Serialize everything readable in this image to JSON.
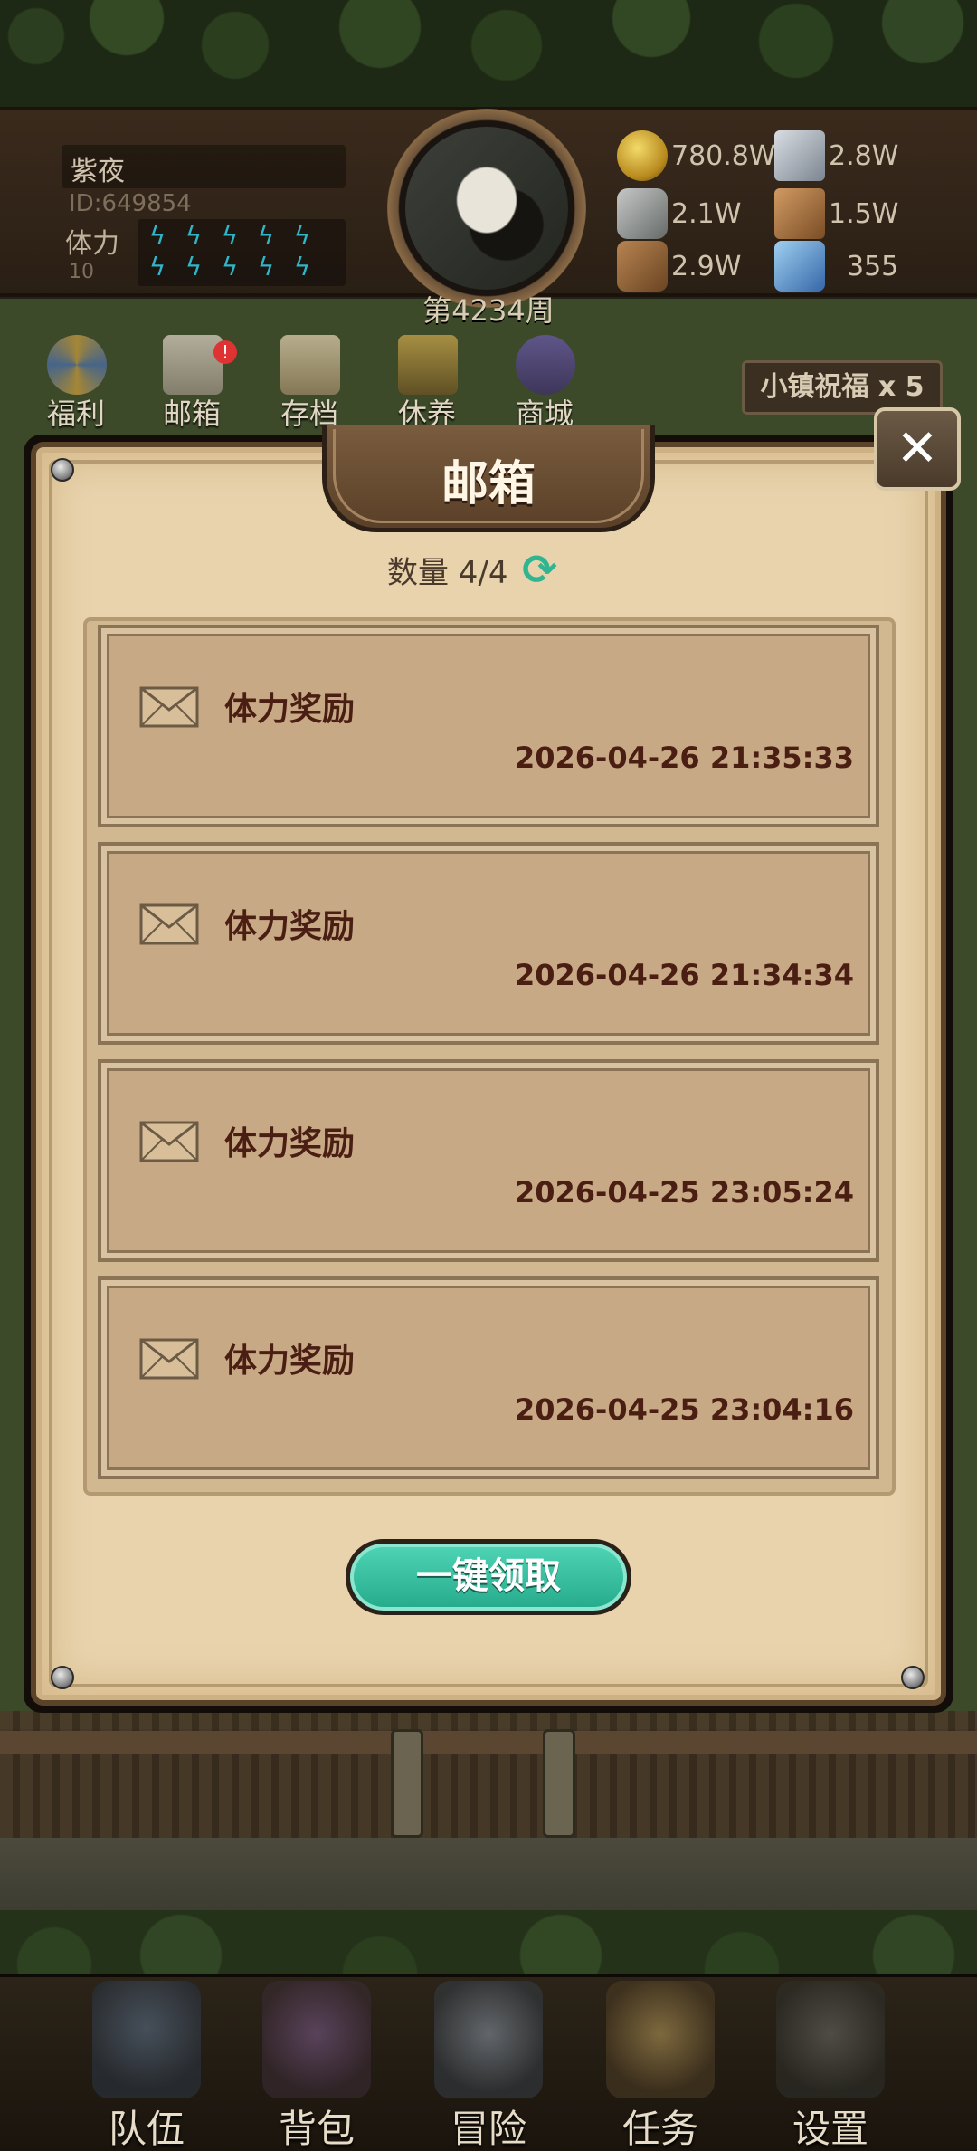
{
  "player": {
    "name": "紫夜",
    "id": "ID:649854",
    "stamina_label": "体力",
    "stamina_value": "10"
  },
  "week_label": "第4234周",
  "resources": [
    {
      "icon": "coin-icon",
      "value": "780.8W"
    },
    {
      "icon": "iron-bar-icon",
      "value": "2.8W"
    },
    {
      "icon": "stone-icon",
      "value": "2.1W"
    },
    {
      "icon": "leather-icon",
      "value": "1.5W"
    },
    {
      "icon": "wood-log-icon",
      "value": "2.9W"
    },
    {
      "icon": "crystal-icon",
      "value": "355"
    }
  ],
  "top_menu": [
    {
      "label": "福利",
      "icon": "welfare-wheel-icon"
    },
    {
      "label": "邮箱",
      "icon": "mailbox-icon",
      "badge": "!"
    },
    {
      "label": "存档",
      "icon": "save-scroll-icon"
    },
    {
      "label": "休养",
      "icon": "rest-bed-icon"
    },
    {
      "label": "商城",
      "icon": "shop-icon"
    }
  ],
  "blessing": "小镇祝福 x 5",
  "mail_panel": {
    "title": "邮箱",
    "count": "数量 4/4",
    "claim_all": "一键领取",
    "items": [
      {
        "title": "体力奖励",
        "date": "2026-04-26 21:35:33"
      },
      {
        "title": "体力奖励",
        "date": "2026-04-26 21:34:34"
      },
      {
        "title": "体力奖励",
        "date": "2026-04-25 23:05:24"
      },
      {
        "title": "体力奖励",
        "date": "2026-04-25 23:04:16"
      }
    ]
  },
  "bottom_nav": [
    {
      "label": "队伍",
      "icon": "helmet-icon"
    },
    {
      "label": "背包",
      "icon": "backpack-icon"
    },
    {
      "label": "冒险",
      "icon": "crossed-swords-icon"
    },
    {
      "label": "任务",
      "icon": "quest-scroll-icon"
    },
    {
      "label": "设置",
      "icon": "gear-icon"
    }
  ],
  "colors": {
    "panel_bg": "#e8d3ad",
    "mail_item_bg": "#c8a985",
    "mail_text": "#4a1e12",
    "claim_button": "#2fbf9c",
    "stamina_bolt": "#2fb6c9"
  }
}
